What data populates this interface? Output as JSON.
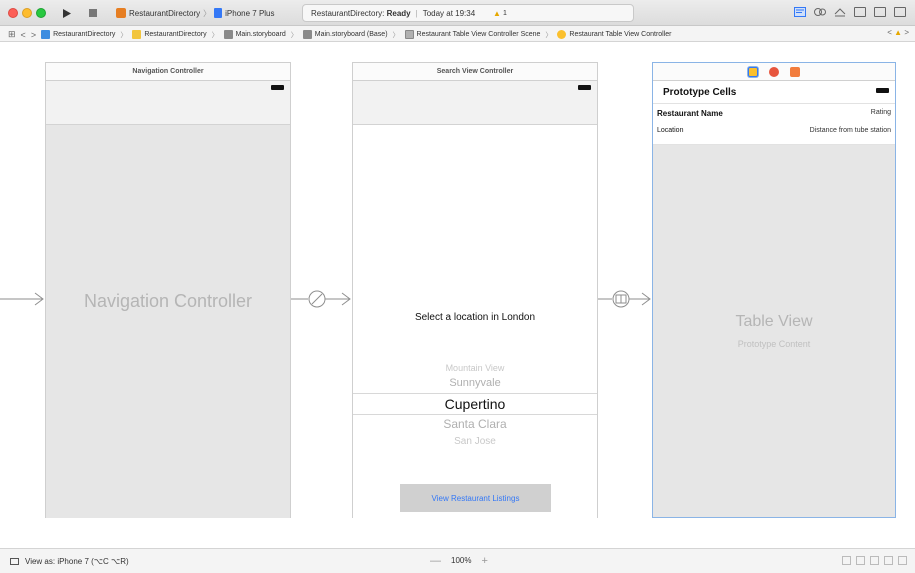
{
  "toolbar": {
    "scheme_target": "RestaurantDirectory",
    "scheme_device": "iPhone 7 Plus",
    "activity_project": "RestaurantDirectory:",
    "activity_state": "Ready",
    "activity_time": "Today at 19:34",
    "warning_count": "1"
  },
  "jumpbar": {
    "crumbs": [
      "RestaurantDirectory",
      "RestaurantDirectory",
      "Main.storyboard",
      "Main.storyboard (Base)",
      "Restaurant Table View Controller Scene",
      "Restaurant Table View Controller"
    ]
  },
  "scenes": {
    "navigation": {
      "title": "Navigation Controller",
      "label": "Navigation Controller"
    },
    "search": {
      "title": "Search View Controller",
      "prompt": "Select a location in London",
      "picker": [
        "Mountain View",
        "Sunnyvale",
        "Cupertino",
        "Santa Clara",
        "San Jose"
      ],
      "button": "View Restaurant Listings"
    },
    "table": {
      "header": "Prototype Cells",
      "cell_title": "Restaurant Name",
      "cell_rating": "Rating",
      "cell_location": "Location",
      "cell_distance": "Distance from tube station",
      "label": "Table View",
      "sublabel": "Prototype Content"
    }
  },
  "bottombar": {
    "view_as": "View as: iPhone 7 (⌥C ⌥R)",
    "zoom": "100%",
    "zoom_minus": "—",
    "zoom_plus": "+"
  },
  "colors": {
    "accent": "#3478f6",
    "selection_border": "#8ab4e6",
    "warning": "#e6a800"
  }
}
